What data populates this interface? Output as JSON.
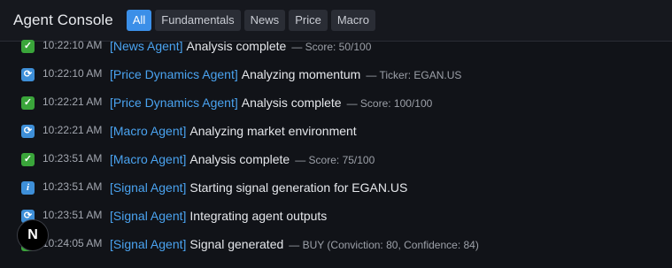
{
  "header": {
    "title": "Agent Console",
    "tabs": [
      {
        "label": "All",
        "active": true
      },
      {
        "label": "Fundamentals",
        "active": false
      },
      {
        "label": "News",
        "active": false
      },
      {
        "label": "Price",
        "active": false
      },
      {
        "label": "Macro",
        "active": false
      }
    ]
  },
  "log": [
    {
      "icon": "check-icon",
      "time": "10:22:10 AM",
      "agent": "[News Agent]",
      "message": "Analysis complete",
      "detail": "— Score: 50/100"
    },
    {
      "icon": "sync-icon",
      "time": "10:22:10 AM",
      "agent": "[Price Dynamics Agent]",
      "message": "Analyzing momentum",
      "detail": "— Ticker: EGAN.US"
    },
    {
      "icon": "check-icon",
      "time": "10:22:21 AM",
      "agent": "[Price Dynamics Agent]",
      "message": "Analysis complete",
      "detail": "— Score: 100/100"
    },
    {
      "icon": "sync-icon",
      "time": "10:22:21 AM",
      "agent": "[Macro Agent]",
      "message": "Analyzing market environment",
      "detail": ""
    },
    {
      "icon": "check-icon",
      "time": "10:23:51 AM",
      "agent": "[Macro Agent]",
      "message": "Analysis complete",
      "detail": "— Score: 75/100"
    },
    {
      "icon": "info-icon",
      "time": "10:23:51 AM",
      "agent": "[Signal Agent]",
      "message": "Starting signal generation for EGAN.US",
      "detail": ""
    },
    {
      "icon": "sync-icon",
      "time": "10:23:51 AM",
      "agent": "[Signal Agent]",
      "message": "Integrating agent outputs",
      "detail": ""
    },
    {
      "icon": "check-icon",
      "time": "10:24:05 AM",
      "agent": "[Signal Agent]",
      "message": "Signal generated",
      "detail": "— BUY (Conviction: 80, Confidence: 84)"
    }
  ],
  "badge": {
    "letter": "N"
  }
}
